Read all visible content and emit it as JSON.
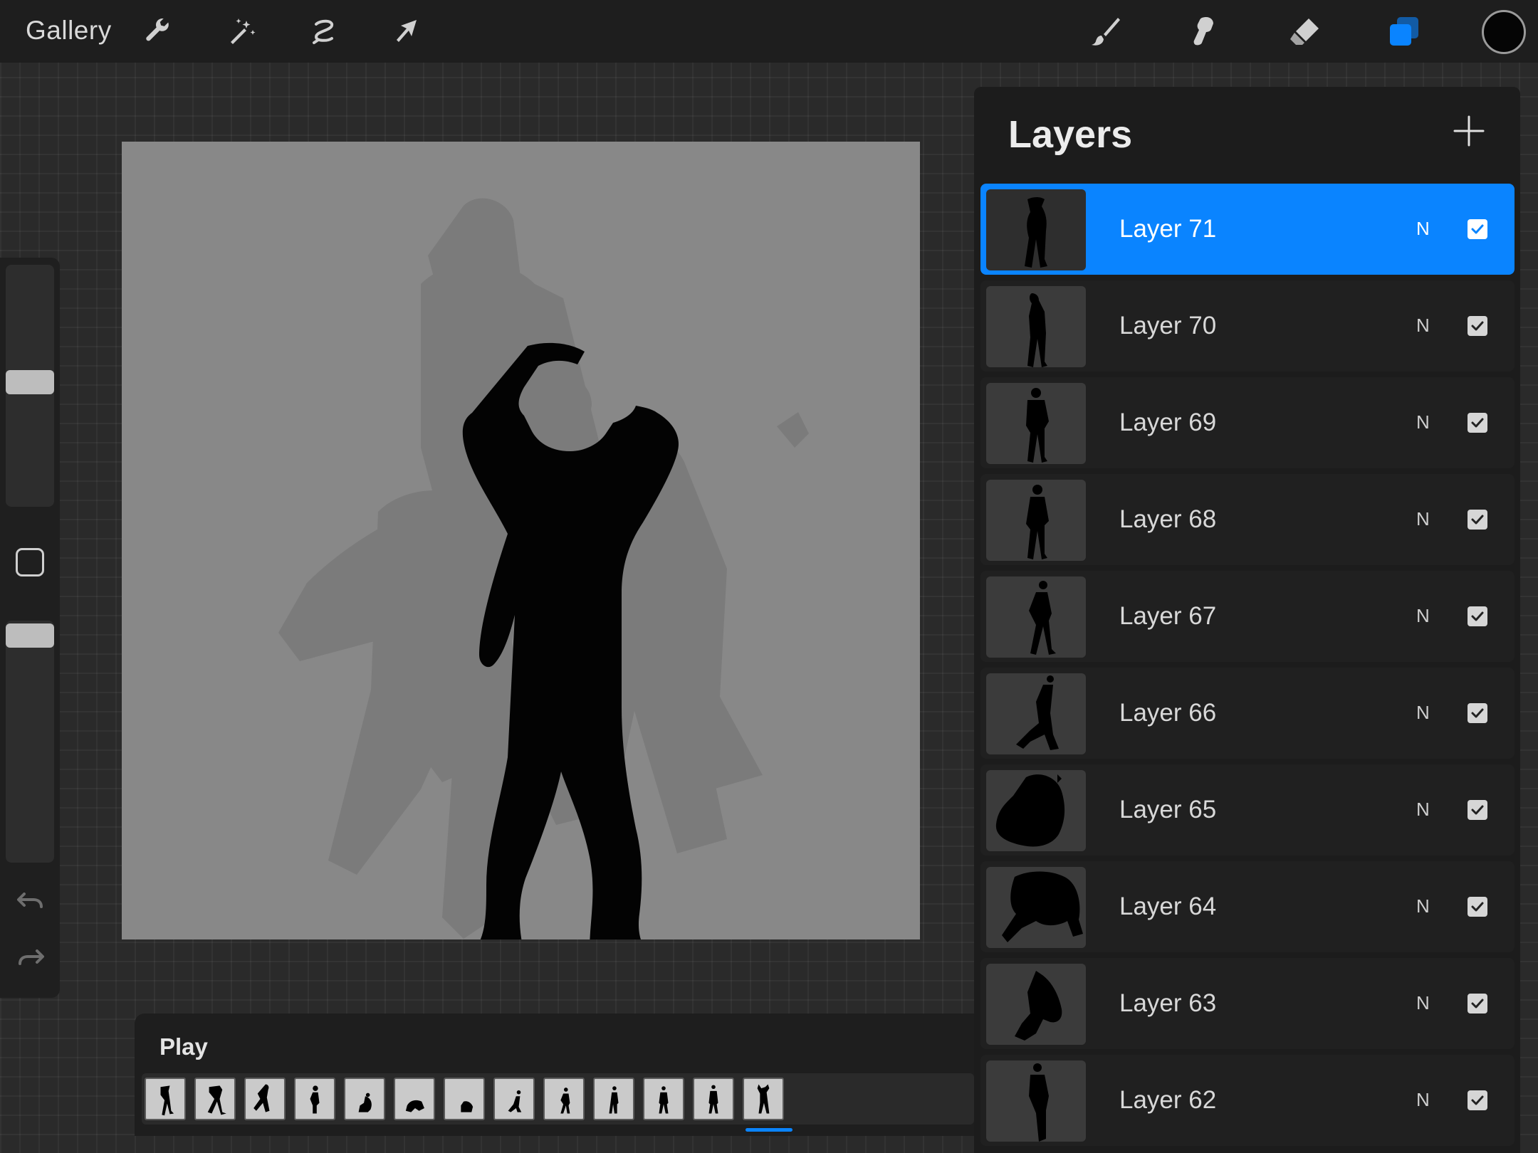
{
  "toolbar": {
    "gallery_label": "Gallery",
    "left_tools": [
      {
        "icon": "wrench-icon"
      },
      {
        "icon": "magic-wand-icon"
      },
      {
        "icon": "selection-icon"
      },
      {
        "icon": "transform-arrow-icon"
      }
    ],
    "right_tools": [
      {
        "icon": "brush-icon"
      },
      {
        "icon": "smudge-icon"
      },
      {
        "icon": "eraser-icon"
      },
      {
        "icon": "layers-icon"
      }
    ],
    "accent_color": "#0a84ff",
    "current_color": "#050505"
  },
  "sidebar": {
    "brush_size_level": 0.52,
    "opacity_level": 0.95
  },
  "layers_panel": {
    "title": "Layers",
    "layers": [
      {
        "name": "Layer 71",
        "blend": "N",
        "visible": true,
        "active": true
      },
      {
        "name": "Layer 70",
        "blend": "N",
        "visible": true,
        "active": false
      },
      {
        "name": "Layer 69",
        "blend": "N",
        "visible": true,
        "active": false
      },
      {
        "name": "Layer 68",
        "blend": "N",
        "visible": true,
        "active": false
      },
      {
        "name": "Layer 67",
        "blend": "N",
        "visible": true,
        "active": false
      },
      {
        "name": "Layer 66",
        "blend": "N",
        "visible": true,
        "active": false
      },
      {
        "name": "Layer 65",
        "blend": "N",
        "visible": true,
        "active": false
      },
      {
        "name": "Layer 64",
        "blend": "N",
        "visible": true,
        "active": false
      },
      {
        "name": "Layer 63",
        "blend": "N",
        "visible": true,
        "active": false
      },
      {
        "name": "Layer 62",
        "blend": "N",
        "visible": true,
        "active": false
      }
    ]
  },
  "animation": {
    "play_label": "Play",
    "frame_count": 13,
    "current_frame": 13
  }
}
